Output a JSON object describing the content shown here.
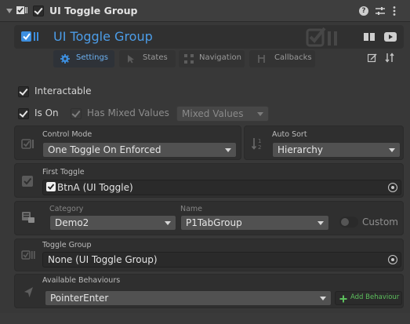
{
  "inspector": {
    "component_title": "UI Toggle Group",
    "component_enabled": true
  },
  "header": {
    "title": "UI Toggle Group",
    "tabs": [
      {
        "label": "Settings",
        "active": true
      },
      {
        "label": "States",
        "active": false
      },
      {
        "label": "Navigation",
        "active": false
      },
      {
        "label": "Callbacks",
        "active": false
      }
    ]
  },
  "settings": {
    "interactable_label": "Interactable",
    "interactable": true,
    "is_on_label": "Is On",
    "is_on": true,
    "has_mixed_label": "Has Mixed Values",
    "has_mixed": true,
    "mixed_values_value": "Mixed Values",
    "control_mode_label": "Control Mode",
    "control_mode_value": "One Toggle On Enforced",
    "auto_sort_label": "Auto Sort",
    "auto_sort_value": "Hierarchy",
    "first_toggle_label": "First Toggle",
    "first_toggle_value": "BtnA (UI Toggle)",
    "category_label": "Category",
    "category_value": "Demo2",
    "name_label": "Name",
    "name_value": "P1TabGroup",
    "custom_label": "Custom",
    "toggle_group_label": "Toggle Group",
    "toggle_group_value": "None (UI Toggle Group)",
    "available_behaviours_label": "Available Behaviours",
    "available_behaviours_value": "PointerEnter",
    "add_behaviour_label": "Add Behaviour"
  },
  "colors": {
    "accent": "#3d8fe0",
    "title_blue": "#4c9de8",
    "add_green": "#5cbf5c"
  }
}
